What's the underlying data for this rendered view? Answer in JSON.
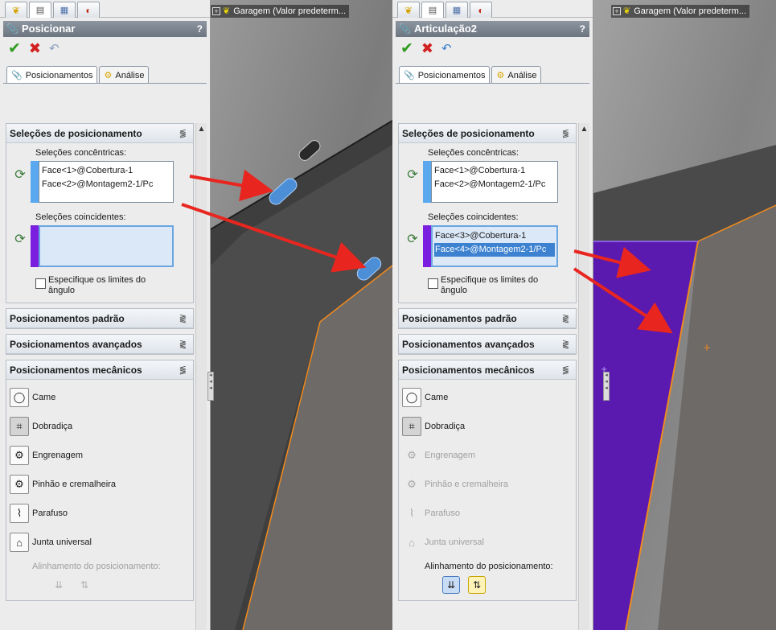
{
  "left": {
    "viewport_title": "Garagem  (Valor predeterm...",
    "pm_title": "Posicionar",
    "help": "?",
    "tabs": [
      "Posicionamentos",
      "Análise"
    ],
    "groups": {
      "selections": "Seleções de posicionamento",
      "concentric_label": "Seleções concêntricas:",
      "concentric_items": [
        "Face<1>@Cobertura-1",
        "Face<2>@Montagem2-1/Pc"
      ],
      "coincident_label": "Seleções coincidentes:",
      "checkbox_label_1": "Especifique os limites do",
      "checkbox_label_2": "ângulo",
      "standard": "Posicionamentos padrão",
      "advanced": "Posicionamentos avançados",
      "mechanical": "Posicionamentos mecânicos"
    },
    "mech_items": [
      "Came",
      "Dobradiça",
      "Engrenagem",
      "Pinhão e cremalheira",
      "Parafuso",
      "Junta universal"
    ],
    "align_label": "Alinhamento do posicionamento:"
  },
  "right": {
    "viewport_title": "Garagem  (Valor predeterm...",
    "pm_title": "Articulação2",
    "help": "?",
    "tabs": [
      "Posicionamentos",
      "Análise"
    ],
    "groups": {
      "selections": "Seleções de posicionamento",
      "concentric_label": "Seleções concêntricas:",
      "concentric_items": [
        "Face<1>@Cobertura-1",
        "Face<2>@Montagem2-1/Pc"
      ],
      "coincident_label": "Seleções coincidentes:",
      "coincident_items": [
        "Face<3>@Cobertura-1",
        "Face<4>@Montagem2-1/Pc"
      ],
      "checkbox_label_1": "Especifique os limites do",
      "checkbox_label_2": "ângulo",
      "standard": "Posicionamentos padrão",
      "advanced": "Posicionamentos avançados",
      "mechanical": "Posicionamentos mecânicos"
    },
    "mech_items": [
      "Came",
      "Dobradiça",
      "Engrenagem",
      "Pinhão e cremalheira",
      "Parafuso",
      "Junta universal"
    ],
    "align_label": "Alinhamento do posicionamento:"
  },
  "icons": {
    "ok": "✔",
    "cancel": "✖",
    "undo": "↶",
    "collapse": "⪓",
    "expand": "⪔",
    "scroll_up": "▲",
    "plus": "+"
  },
  "colors": {
    "concentric_swatch": "#5aa8ee",
    "coincident_swatch": "#7a1fe0",
    "highlight_face": "#5a1ab0",
    "arrow": "#e8261f",
    "edge": "#f08a1e"
  }
}
